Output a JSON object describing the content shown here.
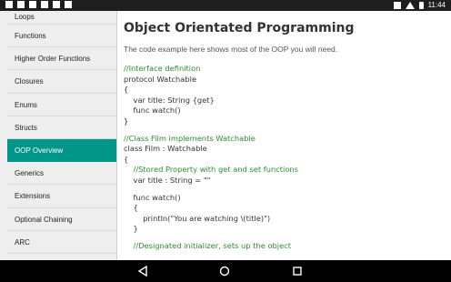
{
  "status_bar": {
    "time": "11:44",
    "left_icons": [
      "notification-icon",
      "notification-icon",
      "notification-icon",
      "tbd-icon",
      "notification-icon",
      "notification-icon"
    ],
    "right_icons": [
      "download-icon",
      "wifi-icon",
      "battery-icon"
    ]
  },
  "sidebar": {
    "items": [
      {
        "label": "Loops"
      },
      {
        "label": "Functions"
      },
      {
        "label": "Higher Order Functions"
      },
      {
        "label": "Closures"
      },
      {
        "label": "Enums"
      },
      {
        "label": "Structs"
      },
      {
        "label": "OOP Overview",
        "active": true
      },
      {
        "label": "Generics"
      },
      {
        "label": "Extensions"
      },
      {
        "label": "Optional Chaining"
      },
      {
        "label": "ARC"
      }
    ]
  },
  "content": {
    "title": "Object Orientated Programming",
    "intro": "The code example here shows most of the OOP you will need.",
    "code_lines": [
      "//Interface definition",
      "protocol Watchable",
      "{",
      "    var title: String {get}",
      "    func watch()",
      "}",
      "",
      "//Class Film implements Watchable",
      "class Film : Watchable",
      "{",
      "    //Stored Property with get and set functions",
      "    var title : String = \"\"",
      "",
      "    func watch()",
      "    {",
      "        println(\"You are watching \\(title)\")",
      "    }",
      "",
      "    //Designated initializer, sets up the object"
    ]
  },
  "nav_bar": {
    "buttons": [
      "back-icon",
      "home-icon",
      "recent-apps-icon"
    ]
  },
  "colors": {
    "accent": "#009688",
    "comment": "#2e8b2e",
    "sidebar_bg": "#eeeeee",
    "status_bar_bg": "#1e1e1e"
  }
}
